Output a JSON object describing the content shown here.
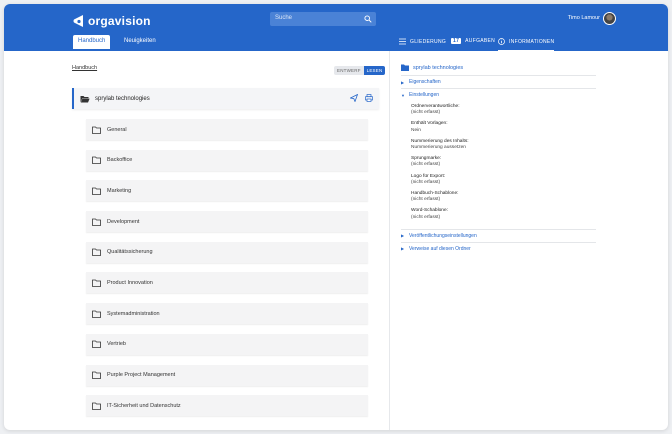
{
  "header": {
    "brand": "orgavision",
    "search_placeholder": "Suche",
    "user_name": "Timo Lamour",
    "tabs": [
      {
        "label": "Handbuch",
        "active": true
      },
      {
        "label": "Neuigkeiten",
        "active": false
      }
    ],
    "right_tabs": [
      {
        "label": "GLIEDERUNG",
        "icon": "list-icon"
      },
      {
        "label": "AUFGABEN",
        "badge": "17",
        "icon": "tasks-icon"
      },
      {
        "label": "INFORMATIONEN",
        "icon": "info-icon",
        "active": true
      }
    ]
  },
  "left": {
    "breadcrumb": "Handbuch",
    "mode_toggle": {
      "edit": "ENTWERF",
      "read": "LESEN",
      "selected": "read"
    },
    "root_folder": "sprylab technologies",
    "folders": [
      "General",
      "Backoffice",
      "Marketing",
      "Development",
      "Qualitätssicherung",
      "Product Innovation",
      "Systemadministration",
      "Vertrieb",
      "Purple Project Management",
      "IT-Sicherheit und Datenschutz"
    ]
  },
  "info": {
    "title": "sprylab technologies",
    "sections": {
      "properties": "Eigenschaften",
      "settings": "Einstellungen",
      "publish": "Veröffentlichungseinstellungen",
      "references": "Verweise auf diesen Ordner"
    },
    "settings": [
      {
        "label": "Ordnerverantwortliche:",
        "value": "(nicht erfasst)"
      },
      {
        "label": "Enthält Vorlagen:",
        "value": "Nein"
      },
      {
        "label": "Nummerierung des Inhalts:",
        "value": "Nummerierung aussetzen"
      },
      {
        "label": "Sprungmarke:",
        "value": "(nicht erfasst)"
      },
      {
        "label": "Logo für Export:",
        "value": "(nicht erfasst)"
      },
      {
        "label": "Handbuch-Schablone:",
        "value": "(nicht erfasst)"
      },
      {
        "label": "Word-Schablone:",
        "value": "(nicht erfasst)"
      }
    ]
  },
  "colors": {
    "brand": "#2566c9",
    "panel": "#f4f4f5"
  }
}
